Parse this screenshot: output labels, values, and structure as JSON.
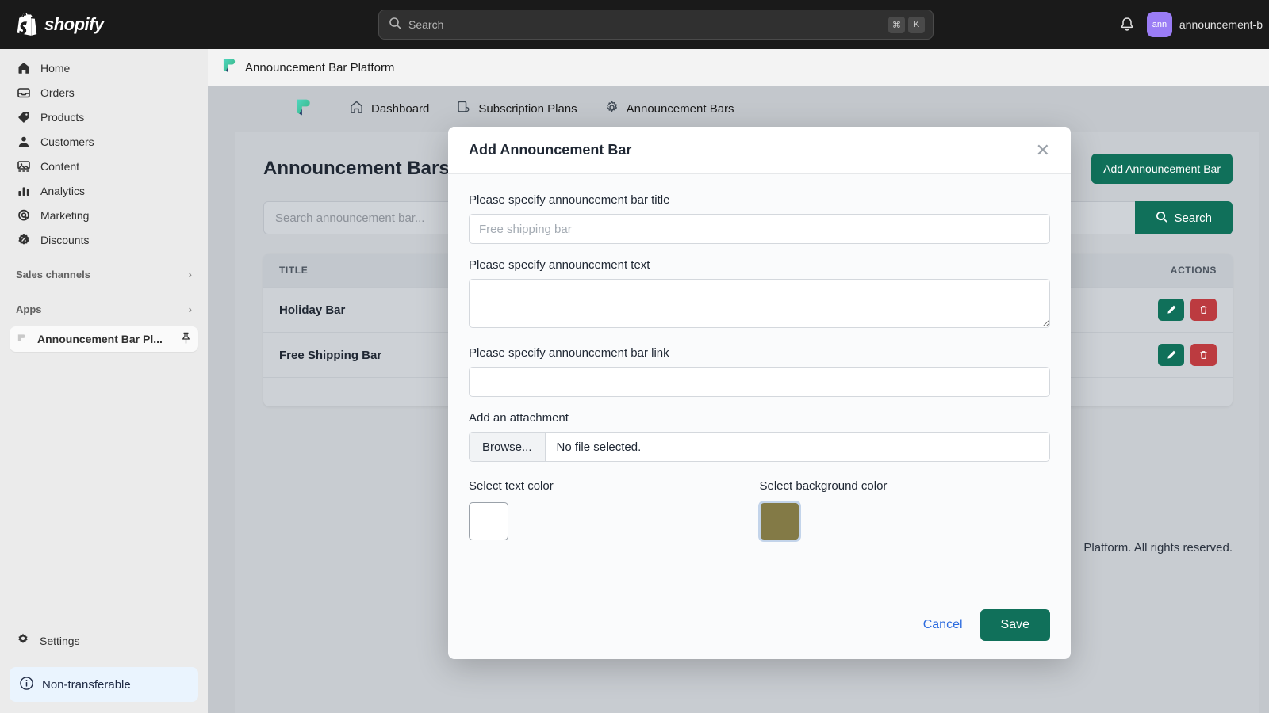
{
  "topbar": {
    "brand": "shopify",
    "brand_logo_icon": "shopify-bag-icon",
    "search": {
      "placeholder": "Search",
      "icon": "search-icon",
      "kbd1": "⌘",
      "kbd2": "K"
    },
    "notifications_icon": "bell-icon",
    "avatar_initials": "ann",
    "user_name": "announcement-b"
  },
  "sidebar": {
    "items": [
      {
        "label": "Home",
        "icon": "home-icon"
      },
      {
        "label": "Orders",
        "icon": "orders-inbox-icon"
      },
      {
        "label": "Products",
        "icon": "product-tag-icon"
      },
      {
        "label": "Customers",
        "icon": "person-icon"
      },
      {
        "label": "Content",
        "icon": "content-image-icon"
      },
      {
        "label": "Analytics",
        "icon": "bar-chart-icon"
      },
      {
        "label": "Marketing",
        "icon": "marketing-target-icon"
      },
      {
        "label": "Discounts",
        "icon": "discount-badge-icon"
      }
    ],
    "sections": [
      {
        "label": "Sales channels",
        "icon": "chevron-right-icon"
      },
      {
        "label": "Apps",
        "icon": "chevron-right-icon"
      }
    ],
    "app_item": {
      "label": "Announcement Bar Pl...",
      "icon": "app-logo-icon",
      "pin_icon": "pin-icon"
    },
    "settings": {
      "label": "Settings",
      "icon": "gear-icon"
    },
    "banner": {
      "label": "Non-transferable",
      "icon": "info-circle-icon"
    }
  },
  "app": {
    "titlebar": {
      "title": "Announcement Bar Platform",
      "icon": "app-logo-icon"
    },
    "nav": [
      {
        "label": "Dashboard",
        "icon": "home-outline-icon"
      },
      {
        "label": "Subscription Plans",
        "icon": "subscription-icon"
      },
      {
        "label": "Announcement Bars",
        "icon": "gear-outline-icon"
      }
    ],
    "page": {
      "title": "Announcement Bars",
      "add_button": "Add Announcement Bar",
      "search_placeholder": "Search announcement bar...",
      "search_button": "Search",
      "search_button_icon": "search-icon",
      "table": {
        "columns": [
          "TITLE",
          "ACTIONS"
        ],
        "rows": [
          {
            "title": "Holiday Bar",
            "edit_icon": "pencil-icon",
            "delete_icon": "trash-icon"
          },
          {
            "title": "Free Shipping Bar",
            "edit_icon": "pencil-icon",
            "delete_icon": "trash-icon"
          }
        ]
      },
      "footer": "Platform. All rights reserved."
    }
  },
  "modal": {
    "title": "Add Announcement Bar",
    "close_icon": "close-icon",
    "fields": {
      "title_label": "Please specify announcement bar title",
      "title_placeholder": "Free shipping bar",
      "title_value": "",
      "text_label": "Please specify announcement text",
      "text_value": "",
      "link_label": "Please specify announcement bar link",
      "link_value": "",
      "attachment_label": "Add an attachment",
      "browse_button": "Browse...",
      "file_status": "No file selected.",
      "text_color_label": "Select text color",
      "text_color_value": "#ffffff",
      "bg_color_label": "Select background color",
      "bg_color_value": "#837a46"
    },
    "cancel_button": "Cancel",
    "save_button": "Save"
  },
  "colors": {
    "brand_green": "#10705a",
    "danger_red": "#bc3b40",
    "link_blue": "#2d6cdf",
    "avatar_purple": "#9a7cf5"
  }
}
